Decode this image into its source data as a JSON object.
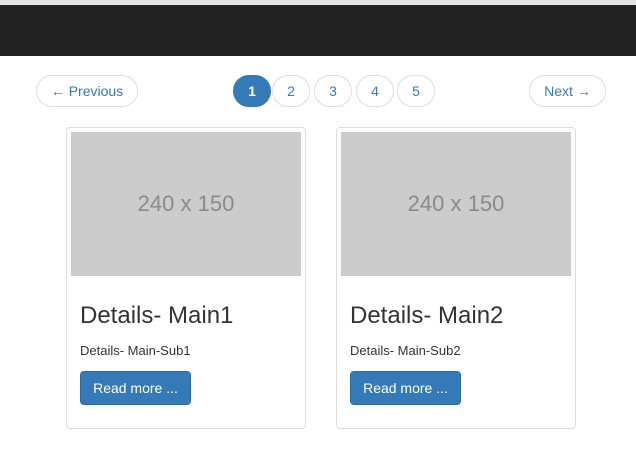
{
  "pagination": {
    "previous_label": "← Previous",
    "next_label": "Next →",
    "pages": [
      "1",
      "2",
      "3",
      "4",
      "5"
    ],
    "active_page": "1"
  },
  "cards": [
    {
      "thumbnail_text": "240 x 150",
      "title": "Details- Main1",
      "subtitle": "Details- Main-Sub1",
      "button_label": "Read more ..."
    },
    {
      "thumbnail_text": "240 x 150",
      "title": "Details- Main2",
      "subtitle": "Details- Main-Sub2",
      "button_label": "Read more ..."
    }
  ],
  "colors": {
    "accent": "#337ab7",
    "navbar": "#222222",
    "placeholder": "#cccccc"
  }
}
